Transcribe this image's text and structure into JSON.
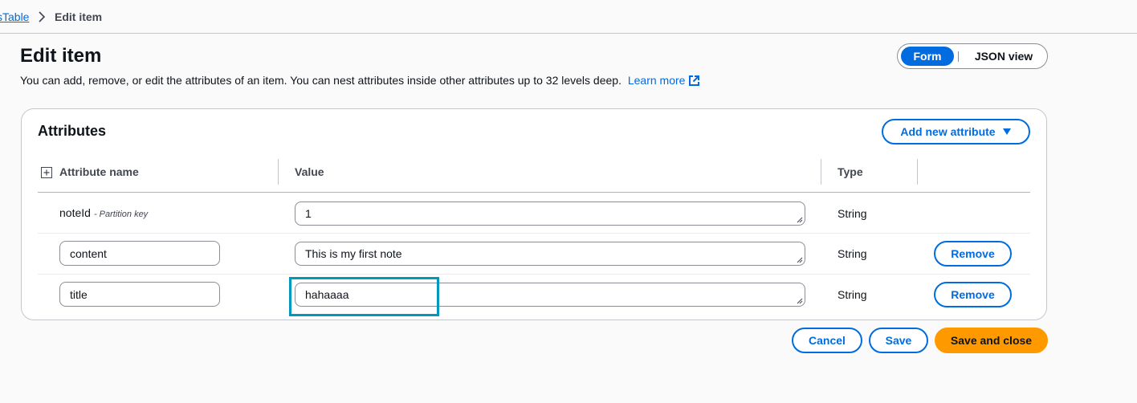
{
  "breadcrumb": {
    "parent_label": "sTable",
    "current_label": "Edit item"
  },
  "page": {
    "title": "Edit item",
    "description": "You can add, remove, or edit the attributes of an item. You can nest attributes inside other attributes up to 32 levels deep.",
    "learn_more": "Learn more"
  },
  "view_toggle": {
    "form_label": "Form",
    "json_label": "JSON view",
    "selected": "Form"
  },
  "attributes": {
    "title": "Attributes",
    "add_button": "Add new attribute",
    "columns": {
      "name": "Attribute name",
      "value": "Value",
      "type": "Type"
    },
    "rows": [
      {
        "name": "noteId",
        "note": "- Partition key",
        "value": "1",
        "type": "String"
      },
      {
        "name": "content",
        "value": "This is my first note",
        "type": "String",
        "remove_label": "Remove"
      },
      {
        "name": "title",
        "value": "hahaaaa",
        "type": "String",
        "remove_label": "Remove"
      }
    ]
  },
  "footer": {
    "cancel": "Cancel",
    "save": "Save",
    "save_and_close": "Save and close"
  },
  "colors": {
    "accent": "#006ce0",
    "primary_button": "#ff9900",
    "focus_highlight": "#0099bb"
  }
}
